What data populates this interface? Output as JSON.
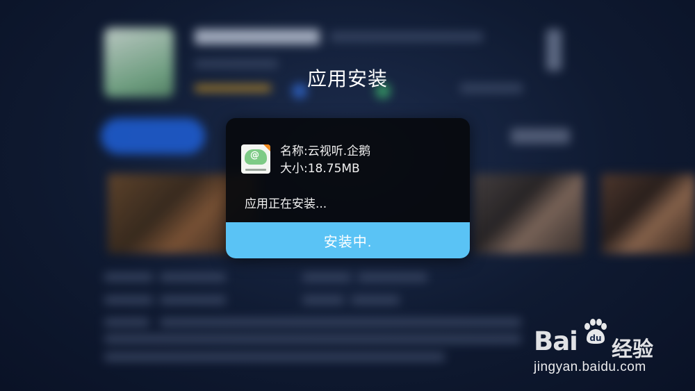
{
  "dialog": {
    "title": "应用安装",
    "app_name": "名称:云视听.企鹅",
    "app_size": "大小:18.75MB",
    "status": "应用正在安装...",
    "button_label": "安装中.",
    "button_color": "#5ac3f5"
  },
  "watermark": {
    "logo_text": "Bai",
    "logo_du": "du",
    "logo_suffix": "经验",
    "url": "jingyan.baidu.com"
  }
}
